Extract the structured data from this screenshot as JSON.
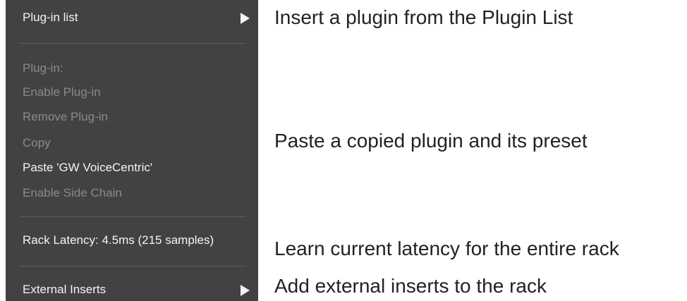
{
  "menu": {
    "plugin_list": "Plug-in list",
    "plugin_header": "Plug-in:",
    "enable_plugin": "Enable Plug-in",
    "remove_plugin": "Remove Plug-in",
    "copy": "Copy",
    "paste": "Paste 'GW VoiceCentric'",
    "enable_side_chain": "Enable Side Chain",
    "rack_latency": "Rack Latency: 4.5ms (215 samples)",
    "external_inserts": "External Inserts"
  },
  "annotations": {
    "plugin_list": "Insert a plugin from the Plugin List",
    "paste": "Paste a copied plugin and its preset",
    "rack_latency": "Learn current latency for the entire rack",
    "external_inserts": "Add external inserts to the rack"
  },
  "colors": {
    "menu_background": "#424242",
    "enabled_text": "#f4f4f4",
    "disabled_text": "#8a8a8a",
    "separator": "#5e5e5e",
    "annotation_text": "#222222"
  },
  "icons": {
    "submenu": "triangle-right-icon"
  }
}
